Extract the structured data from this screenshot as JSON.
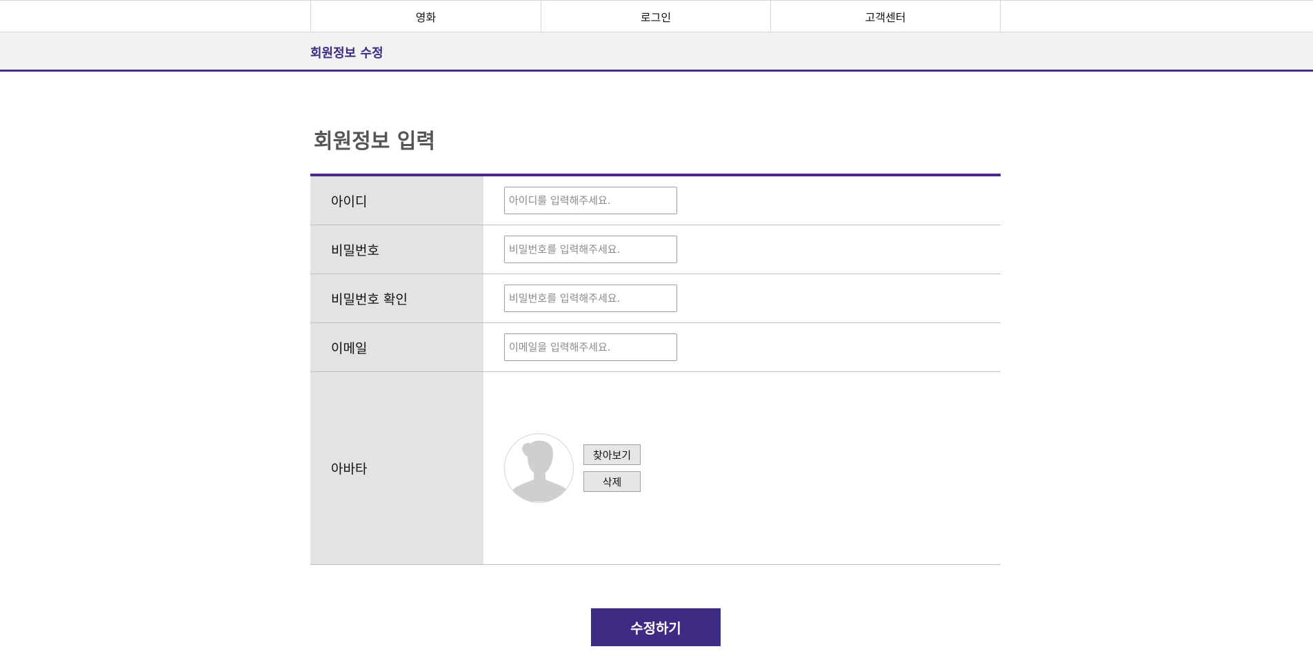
{
  "nav": {
    "items": [
      {
        "label": "영화"
      },
      {
        "label": "로그인"
      },
      {
        "label": "고객센터"
      }
    ]
  },
  "subheader": {
    "title": "회원정보 수정"
  },
  "section": {
    "title": "회원정보 입력"
  },
  "form": {
    "rows": [
      {
        "label": "아이디",
        "placeholder": "아이디를 입력해주세요.",
        "value": ""
      },
      {
        "label": "비밀번호",
        "placeholder": "비밀번호를 입력해주세요.",
        "value": ""
      },
      {
        "label": "비밀번호 확인",
        "placeholder": "비밀번호를 입력해주세요.",
        "value": ""
      },
      {
        "label": "이메일",
        "placeholder": "이메일을 입력해주세요.",
        "value": ""
      }
    ],
    "avatar": {
      "label": "아바타",
      "browse_label": "찾아보기",
      "delete_label": "삭제",
      "icon": "user-silhouette-icon"
    }
  },
  "submit": {
    "label": "수정하기"
  },
  "colors": {
    "accent": "#4b2a8c",
    "button_bg": "#3f2a84",
    "label_bg": "#e3e3e3",
    "subheader_bg": "#f2f2f2"
  }
}
